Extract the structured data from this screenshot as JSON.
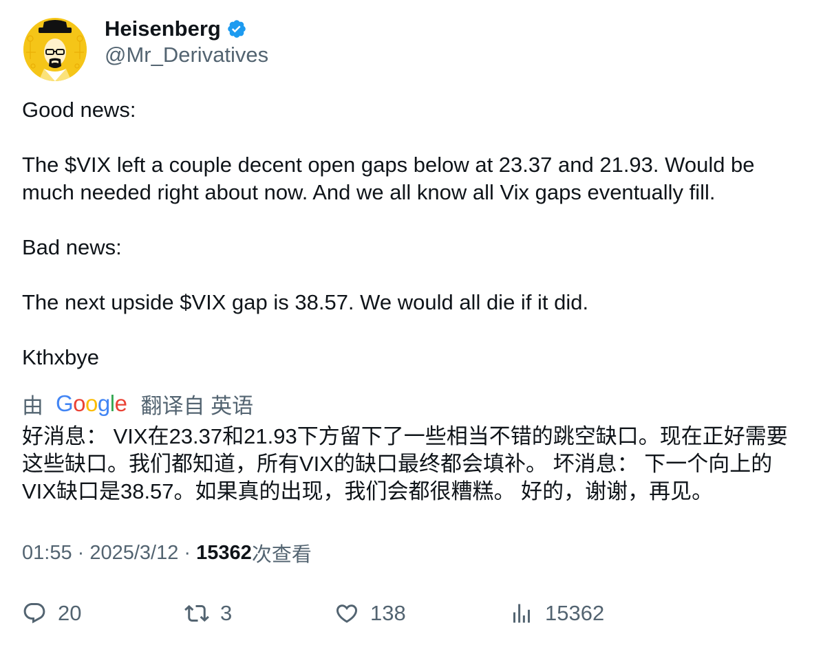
{
  "author": {
    "display_name": "Heisenberg",
    "handle": "@Mr_Derivatives",
    "verified_color": "#1d9bf0"
  },
  "tweet": {
    "paragraphs": [
      "Good news:",
      "The $VIX left a couple decent open gaps below at 23.37 and 21.93. Would be much needed right about now. And we all know all Vix gaps eventually fill.",
      "Bad news:",
      "The next upside $VIX gap is 38.57. We would all die if it did.",
      "Kthxbye"
    ]
  },
  "translation": {
    "prefix": "由",
    "provider": "Google",
    "suffix": "翻译自 英语",
    "text": "好消息： VIX在23.37和21.93下方留下了一些相当不错的跳空缺口。现在正好需要这些缺口。我们都知道，所有VIX的缺口最终都会填补。 坏消息： 下一个向上的VIX缺口是38.57。如果真的出现，我们会都很糟糕。 好的，谢谢，再见。"
  },
  "meta": {
    "time": "01:55",
    "separator": " · ",
    "date": "2025/3/12",
    "views_count": "15362",
    "views_label": "次查看"
  },
  "actions": {
    "reply_count": "20",
    "retweet_count": "3",
    "like_count": "138",
    "views_count": "15362"
  },
  "colors": {
    "text": "#0f1419",
    "secondary": "#536471",
    "accent": "#1d9bf0",
    "google_blue": "#4285F4",
    "google_red": "#EA4335",
    "google_yellow": "#FBBC05",
    "google_green": "#34A853"
  }
}
